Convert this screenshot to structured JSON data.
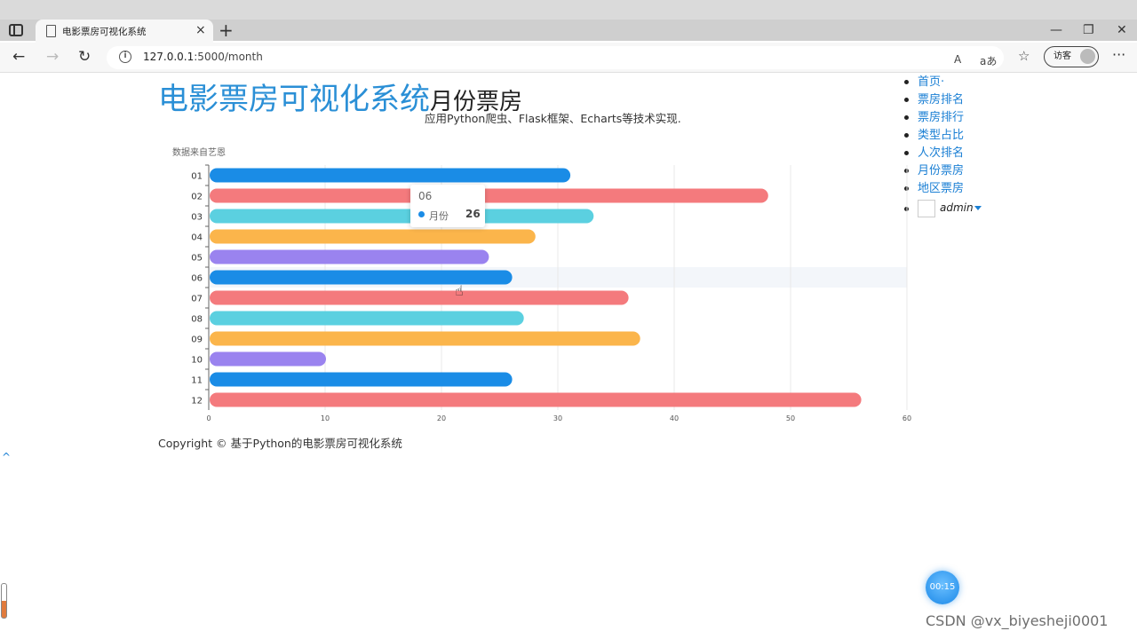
{
  "browser": {
    "tab_title": "电影票房可视化系统",
    "tab_close": "×",
    "new_tab": "+",
    "url_host": "127.0.0.1",
    "url_path": ":5000/month",
    "guest_label": "访客",
    "read_aloud_icon": "A",
    "translate_icon": "aあ",
    "more": "···"
  },
  "header": {
    "brand": "电影票房可视化系统",
    "section": "月份票房",
    "subtitle": "应用Python爬虫、Flask框架、Echarts等技术实现."
  },
  "nav": {
    "items": [
      "首页·",
      "票房排名",
      "票房排行",
      "类型占比",
      "人次排名",
      "月份票房",
      "地区票房"
    ],
    "user": "admin"
  },
  "chart_source": "数据来自艺恩",
  "tooltip": {
    "title": "06",
    "series": "月份",
    "value": "26"
  },
  "footer": {
    "copyright": "Copyright © 基于Python的电影票房可视化系统"
  },
  "scroll_top": "^",
  "timer": "00:15",
  "watermark": "CSDN @vx_biyesheji0001",
  "colors": {
    "bar_palette": [
      "#1a8ce6",
      "#f47a7d",
      "#5bd0e0",
      "#fbb54b",
      "#9a83ef"
    ],
    "brand": "#2a8fd6",
    "link": "#1a7fd4"
  },
  "chart_data": {
    "type": "bar",
    "orientation": "horizontal",
    "categories": [
      "01",
      "02",
      "03",
      "04",
      "05",
      "06",
      "07",
      "08",
      "09",
      "10",
      "11",
      "12"
    ],
    "series": [
      {
        "name": "月份",
        "values": [
          31,
          48,
          33,
          28,
          24,
          26,
          36,
          27,
          37,
          10,
          26,
          56
        ]
      }
    ],
    "xlim": [
      0,
      60
    ],
    "xticks": [
      0,
      10,
      20,
      30,
      40,
      50,
      60
    ],
    "highlighted_category": "06"
  }
}
